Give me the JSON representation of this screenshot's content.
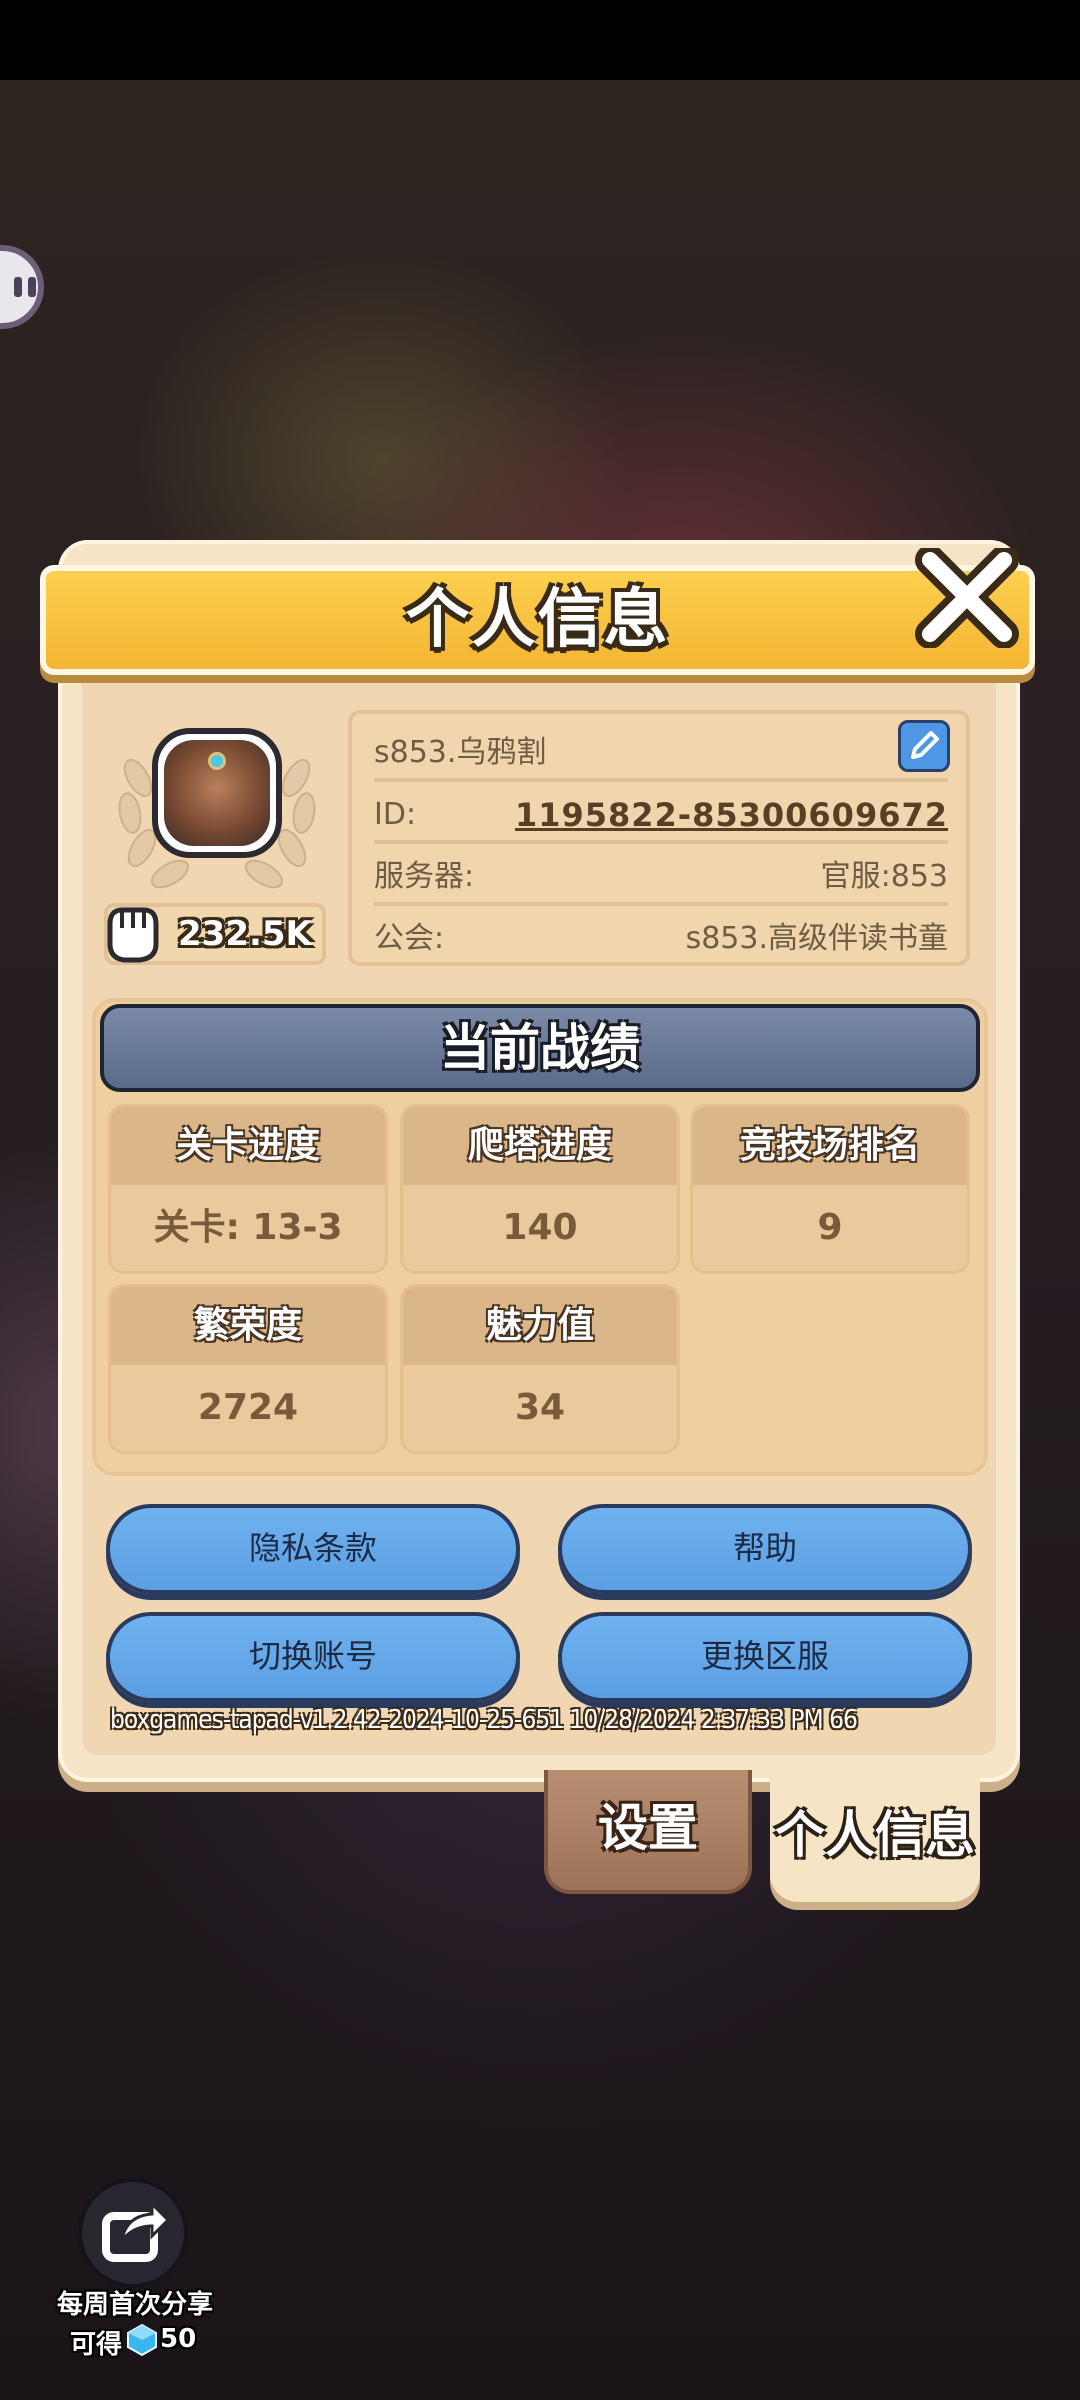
{
  "dialog": {
    "title": "个人信息"
  },
  "profile": {
    "power": "232.5K",
    "name": "s853.乌鸦割",
    "id_label": "ID:",
    "id_value": "1195822-85300609672",
    "server_label": "服务器:",
    "server_value": "官服:853",
    "guild_label": "公会:",
    "guild_value": "s853.高级伴读书童"
  },
  "stats": {
    "header": "当前战绩",
    "cells": [
      {
        "label": "关卡进度",
        "value": "关卡: 13-3"
      },
      {
        "label": "爬塔进度",
        "value": "140"
      },
      {
        "label": "竞技场排名",
        "value": "9"
      },
      {
        "label": "繁荣度",
        "value": "2724"
      },
      {
        "label": "魅力值",
        "value": "34"
      }
    ]
  },
  "buttons": {
    "privacy": "隐私条款",
    "help": "帮助",
    "switch_account": "切换账号",
    "change_server": "更换区服"
  },
  "version": "boxgames-tapad-v1.2.42-2024-10-25-651 10/28/2024 2:37:33 PM 66",
  "tabs": {
    "settings": "设置",
    "profile": "个人信息"
  },
  "share": {
    "line1": "每周首次分享",
    "line2": "可得",
    "amount": "50"
  },
  "colors": {
    "banner": "#f4b532",
    "panel": "#f6e4c6",
    "button_blue": "#5b9fe4",
    "stats_header": "#5a6b8a"
  },
  "icons": [
    "close-icon",
    "edit-icon",
    "fist-icon",
    "share-icon",
    "gem-icon"
  ]
}
